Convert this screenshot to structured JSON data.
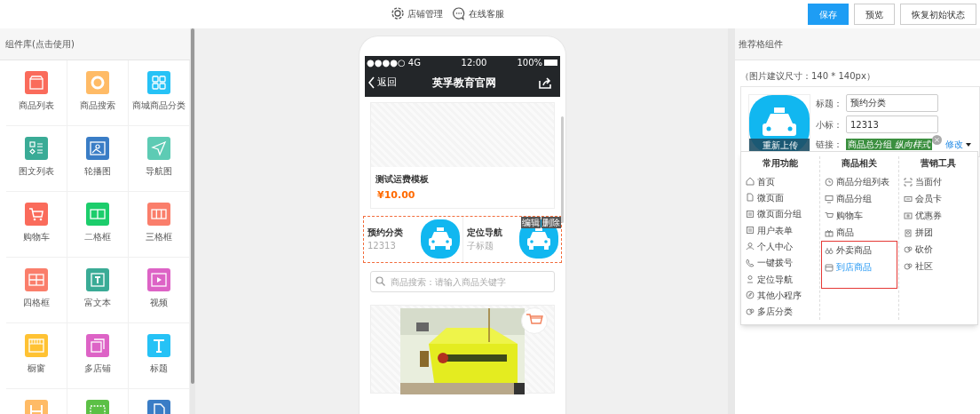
{
  "header": {
    "links": [
      {
        "label": "店铺管理",
        "kind": "gear"
      },
      {
        "label": "在线客服",
        "kind": "chat"
      }
    ],
    "buttons": [
      {
        "label": "保存",
        "kind": "primary"
      },
      {
        "label": "预览",
        "kind": "default"
      },
      {
        "label": "恢复初始状态",
        "kind": "default"
      }
    ]
  },
  "component_library": {
    "title": "组件库(点击使用)",
    "items": [
      {
        "label": "商品列表",
        "color": "#fa6b5b"
      },
      {
        "label": "商品搜索",
        "color": "#ffbb66"
      },
      {
        "label": "商城商品分类",
        "color": "#26c2f6"
      },
      {
        "label": "图文列表",
        "color": "#3aab96"
      },
      {
        "label": "轮播图",
        "color": "#3a7dc6"
      },
      {
        "label": "导航图",
        "color": "#5dcbb4"
      },
      {
        "label": "购物车",
        "color": "#fa6b5b"
      },
      {
        "label": "二格框",
        "color": "#1ccd6b"
      },
      {
        "label": "三格框",
        "color": "#fa7e6b"
      },
      {
        "label": "四格框",
        "color": "#fa7e6b"
      },
      {
        "label": "富文本",
        "color": "#3aab96"
      },
      {
        "label": "视频",
        "color": "#dd63c6"
      },
      {
        "label": "橱窗",
        "color": "#ffc233"
      },
      {
        "label": "多店铺",
        "color": "#dd63c6"
      },
      {
        "label": "标题",
        "color": "#26c2f6"
      },
      {
        "color": "#ffbb66"
      },
      {
        "color": "#5cc046"
      },
      {
        "color": "#3a7dc6"
      }
    ]
  },
  "phone": {
    "status_bar": {
      "signal": "●●●●○ 4G",
      "time": "12:00",
      "battery": "100%"
    },
    "nav": {
      "back": "返回",
      "title": "英孚教育官网"
    },
    "product": {
      "name": "测试运费模板",
      "price": "¥10.00"
    },
    "nav_block": {
      "tags": [
        "编辑",
        "删除"
      ],
      "items": [
        {
          "title": "预约分类",
          "subtitle": "12313"
        },
        {
          "title": "定位导航",
          "subtitle": "子标题"
        }
      ]
    },
    "search": {
      "placeholder": "商品搜索：请输入商品关键字"
    }
  },
  "settings": {
    "title": "推荐格组件",
    "hint": "（图片建议尺寸：140 * 140px）",
    "reupload": "重新上传",
    "fields": [
      {
        "label": "标题：",
        "value": "预约分类"
      },
      {
        "label": "小标：",
        "value": "12313"
      }
    ],
    "link": {
      "label": "链接：",
      "tag": "商品总分组 *纵向样式*",
      "change": "修改"
    },
    "menu": {
      "columns": [
        {
          "title": "常用功能",
          "items": [
            {
              "label": "首页",
              "selected": false,
              "boxed": false
            },
            {
              "label": "微页面",
              "selected": false,
              "boxed": false
            },
            {
              "label": "微页面分组",
              "selected": false,
              "boxed": false
            },
            {
              "label": "用户表单",
              "selected": false,
              "boxed": false
            },
            {
              "label": "个人中心",
              "selected": false,
              "boxed": false
            },
            {
              "label": "一键拨号",
              "selected": false,
              "boxed": false
            },
            {
              "label": "定位导航",
              "selected": false,
              "boxed": false
            },
            {
              "label": "其他小程序",
              "selected": false,
              "boxed": false
            },
            {
              "label": "多店分类",
              "selected": false,
              "boxed": false
            }
          ]
        },
        {
          "title": "商品相关",
          "items": [
            {
              "label": "商品分组列表",
              "selected": false,
              "boxed": false
            },
            {
              "label": "商品分组",
              "selected": false,
              "boxed": false
            },
            {
              "label": "购物车",
              "selected": false,
              "boxed": false
            },
            {
              "label": "商品",
              "selected": false,
              "boxed": false
            },
            {
              "label": "外卖商品",
              "selected": false,
              "boxed": true
            },
            {
              "label": "到店商品",
              "selected": true,
              "boxed": true
            }
          ]
        },
        {
          "title": "营销工具",
          "items": [
            {
              "label": "当面付",
              "selected": false,
              "boxed": false
            },
            {
              "label": "会员卡",
              "selected": false,
              "boxed": false
            },
            {
              "label": "优惠券",
              "selected": false,
              "boxed": false
            },
            {
              "label": "拼团",
              "selected": false,
              "boxed": false
            },
            {
              "label": "砍价",
              "selected": false,
              "boxed": false
            },
            {
              "label": "社区",
              "selected": false,
              "boxed": false
            }
          ]
        }
      ]
    }
  }
}
